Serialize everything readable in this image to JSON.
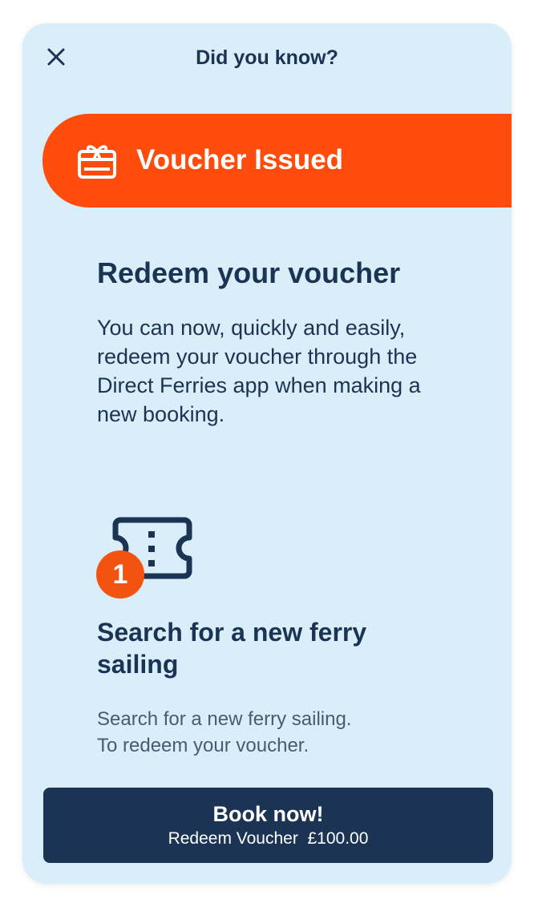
{
  "header": {
    "title": "Did you know?",
    "close_icon": "close-icon"
  },
  "banner": {
    "icon": "gift-card-icon",
    "label": "Voucher Issued",
    "color": "#ff4c0c"
  },
  "intro": {
    "title": "Redeem your voucher",
    "body": "You can now, quickly and easily, redeem your voucher through the Direct Ferries app when making a new booking."
  },
  "step": {
    "icon": "ticket-icon",
    "number": "1",
    "title": "Search for a new ferry sailing",
    "description_line1": "Search for a new ferry sailing.",
    "description_line2": "To redeem your voucher."
  },
  "cta": {
    "label": "Book now!",
    "sub_label": "Redeem Voucher  £100.00",
    "color": "#1c3454"
  },
  "colors": {
    "background": "#d9eef9",
    "text": "#1c3454",
    "accent": "#f4520f"
  }
}
